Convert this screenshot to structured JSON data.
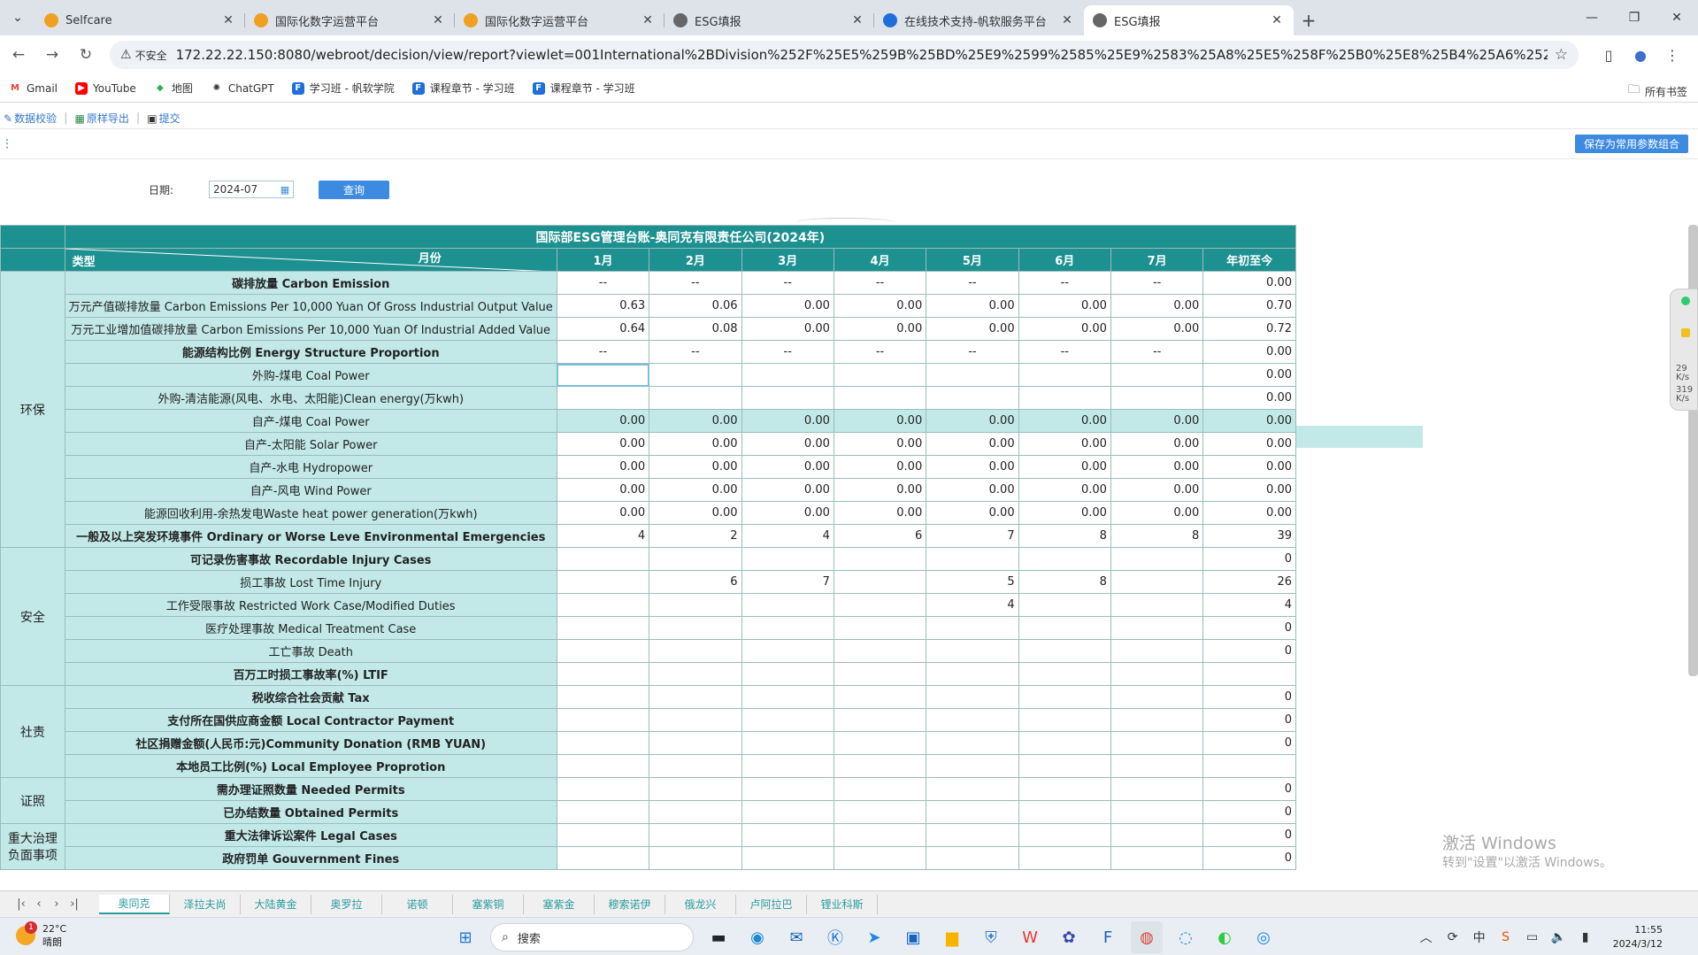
{
  "browser": {
    "tabs": [
      {
        "label": "Selfcare",
        "icon": "orange-circle-icon",
        "color": "#f0a020"
      },
      {
        "label": "国际化数字运营平台",
        "icon": "orange-circle-icon",
        "color": "#f0a020"
      },
      {
        "label": "国际化数字运营平台",
        "icon": "orange-circle-icon",
        "color": "#f0a020"
      },
      {
        "label": "ESG填报",
        "icon": "globe-icon",
        "color": "#666666"
      },
      {
        "label": "在线技术支持-帆软服务平台",
        "icon": "fanruan-icon",
        "color": "#1e6fd9"
      },
      {
        "label": "ESG填报",
        "icon": "globe-icon",
        "color": "#666666",
        "active": true
      }
    ],
    "security_label": "不安全",
    "url": "172.22.22.150:8080/webroot/decision/view/report?viewlet=001International%2BDivision%252F%25E5%259B%25BD%25E9%2599%2585%25E9%2583%25A8%25E5%258F%25B0%25E8%25B4%25A6%252FESG%252FESG%25E5%25A...",
    "bookmarks": [
      {
        "label": "Gmail",
        "icon": "gmail-icon"
      },
      {
        "label": "YouTube",
        "icon": "youtube-icon"
      },
      {
        "label": "地图",
        "icon": "maps-icon"
      },
      {
        "label": "ChatGPT",
        "icon": "chatgpt-icon"
      },
      {
        "label": "学习班 - 帆软学院",
        "icon": "fanruan-icon"
      },
      {
        "label": "课程章节 - 学习班",
        "icon": "fanruan-icon"
      },
      {
        "label": "课程章节 - 学习班",
        "icon": "fanruan-icon"
      }
    ],
    "all_bookmarks": "所有书签"
  },
  "report_toolbar": {
    "validate": "数据校验",
    "export": "原样导出",
    "submit": "提交",
    "save_params": "保存为常用参数组合"
  },
  "params": {
    "date_label": "日期:",
    "date_value": "2024-07",
    "query": "查询"
  },
  "table": {
    "title": "国际部ESG管理台账-奥同克有限责任公司(2024年)",
    "corner_month": "月份",
    "corner_type": "类型",
    "months": [
      "1月",
      "2月",
      "3月",
      "4月",
      "5月",
      "6月",
      "7月",
      "年初至今"
    ],
    "rows": [
      {
        "cat": "环保",
        "label": "碳排放量 Carbon Emission",
        "bold": true,
        "vals": [
          "--",
          "--",
          "--",
          "--",
          "--",
          "--",
          "--",
          "0.00"
        ],
        "center": true
      },
      {
        "label": "万元产值碳排放量 Carbon Emissions Per 10,000 Yuan Of Gross Industrial Output Value",
        "vals": [
          "0.63",
          "0.06",
          "0.00",
          "0.00",
          "0.00",
          "0.00",
          "0.00",
          "0.70"
        ]
      },
      {
        "label": "万元工业增加值碳排放量 Carbon Emissions Per 10,000 Yuan Of Industrial Added Value",
        "vals": [
          "0.64",
          "0.08",
          "0.00",
          "0.00",
          "0.00",
          "0.00",
          "0.00",
          "0.72"
        ]
      },
      {
        "label": "能源结构比例 Energy Structure Proportion",
        "bold": true,
        "vals": [
          "--",
          "--",
          "--",
          "--",
          "--",
          "--",
          "--",
          "0.00"
        ],
        "center": true
      },
      {
        "label": "外购-煤电 Coal Power",
        "vals": [
          "",
          "",
          "",
          "",
          "",
          "",
          "",
          "0.00"
        ],
        "sel": true
      },
      {
        "label": "外购-清洁能源(风电、水电、太阳能)Clean energy(万kwh)",
        "vals": [
          "",
          "",
          "",
          "",
          "",
          "",
          "",
          "0.00"
        ]
      },
      {
        "label": "自产-煤电 Coal Power",
        "vals": [
          "0.00",
          "0.00",
          "0.00",
          "0.00",
          "0.00",
          "0.00",
          "0.00",
          "0.00"
        ],
        "hl": true
      },
      {
        "label": "自产-太阳能 Solar Power",
        "vals": [
          "0.00",
          "0.00",
          "0.00",
          "0.00",
          "0.00",
          "0.00",
          "0.00",
          "0.00"
        ]
      },
      {
        "label": "自产-水电 Hydropower",
        "vals": [
          "0.00",
          "0.00",
          "0.00",
          "0.00",
          "0.00",
          "0.00",
          "0.00",
          "0.00"
        ]
      },
      {
        "label": "自产-风电 Wind Power",
        "vals": [
          "0.00",
          "0.00",
          "0.00",
          "0.00",
          "0.00",
          "0.00",
          "0.00",
          "0.00"
        ]
      },
      {
        "label": "能源回收利用-余热发电Waste heat power generation(万kwh)",
        "vals": [
          "0.00",
          "0.00",
          "0.00",
          "0.00",
          "0.00",
          "0.00",
          "0.00",
          "0.00"
        ]
      },
      {
        "label": "一般及以上突发环境事件 Ordinary or Worse Leve Environmental Emergencies",
        "bold": true,
        "vals": [
          "4",
          "2",
          "4",
          "6",
          "7",
          "8",
          "8",
          "39"
        ]
      },
      {
        "cat": "安全",
        "label": "可记录伤害事故 Recordable Injury Cases",
        "bold": true,
        "vals": [
          "",
          "",
          "",
          "",
          "",
          "",
          "",
          "0"
        ]
      },
      {
        "label": "损工事故 Lost Time Injury",
        "vals": [
          "",
          "6",
          "7",
          "",
          "5",
          "8",
          "",
          "26"
        ]
      },
      {
        "label": "工作受限事故 Restricted Work Case/Modified Duties",
        "vals": [
          "",
          "",
          "",
          "",
          "4",
          "",
          "",
          "4"
        ]
      },
      {
        "label": "医疗处理事故 Medical Treatment Case",
        "vals": [
          "",
          "",
          "",
          "",
          "",
          "",
          "",
          "0"
        ]
      },
      {
        "label": "工亡事故 Death",
        "vals": [
          "",
          "",
          "",
          "",
          "",
          "",
          "",
          "0"
        ]
      },
      {
        "label": "百万工时损工事故率(%) LTIF",
        "bold": true,
        "vals": [
          "",
          "",
          "",
          "",
          "",
          "",
          "",
          ""
        ]
      },
      {
        "cat": "社责",
        "label": "税收综合社会贡献 Tax",
        "bold": true,
        "vals": [
          "",
          "",
          "",
          "",
          "",
          "",
          "",
          "0"
        ]
      },
      {
        "label": "支付所在国供应商金额 Local Contractor Payment",
        "bold": true,
        "vals": [
          "",
          "",
          "",
          "",
          "",
          "",
          "",
          "0"
        ]
      },
      {
        "label": "社区捐赠金额(人民币:元)Community Donation (RMB YUAN)",
        "bold": true,
        "vals": [
          "",
          "",
          "",
          "",
          "",
          "",
          "",
          "0"
        ]
      },
      {
        "label": "本地员工比例(%) Local Employee Proprotion",
        "bold": true,
        "vals": [
          "",
          "",
          "",
          "",
          "",
          "",
          "",
          ""
        ]
      },
      {
        "cat": "证照",
        "label": "需办理证照数量 Needed Permits",
        "bold": true,
        "vals": [
          "",
          "",
          "",
          "",
          "",
          "",
          "",
          "0"
        ]
      },
      {
        "label": "已办结数量 Obtained Permits",
        "bold": true,
        "vals": [
          "",
          "",
          "",
          "",
          "",
          "",
          "",
          "0"
        ]
      },
      {
        "cat": "重大治理负面事项",
        "label": "重大法律诉讼案件 Legal Cases",
        "bold": true,
        "vals": [
          "",
          "",
          "",
          "",
          "",
          "",
          "",
          "0"
        ]
      },
      {
        "label": "政府罚单 Gouvernment Fines",
        "bold": true,
        "vals": [
          "",
          "",
          "",
          "",
          "",
          "",
          "",
          "0"
        ]
      }
    ],
    "cat_spans": {
      "环保": 12,
      "安全": 6,
      "社责": 4,
      "证照": 2,
      "重大治理负面事项": 2
    }
  },
  "sheets": [
    "奥同克",
    "泽拉夫尚",
    "大陆黄金",
    "奥罗拉",
    "诺顿",
    "塞紫铜",
    "塞紫金",
    "穆索诺伊",
    "俄龙兴",
    "卢阿拉巴",
    "锂业科斯"
  ],
  "watermark": {
    "line1": "激活 Windows",
    "line2": "转到\"设置\"以激活 Windows。"
  },
  "gadget": {
    "v1": "29",
    "u1": "K/s",
    "v2": "319",
    "u2": "K/s"
  },
  "taskbar": {
    "temp": "22°C",
    "weather": "晴朗",
    "badge": "1",
    "search": "搜索",
    "time": "11:55",
    "date": "2024/3/12"
  }
}
